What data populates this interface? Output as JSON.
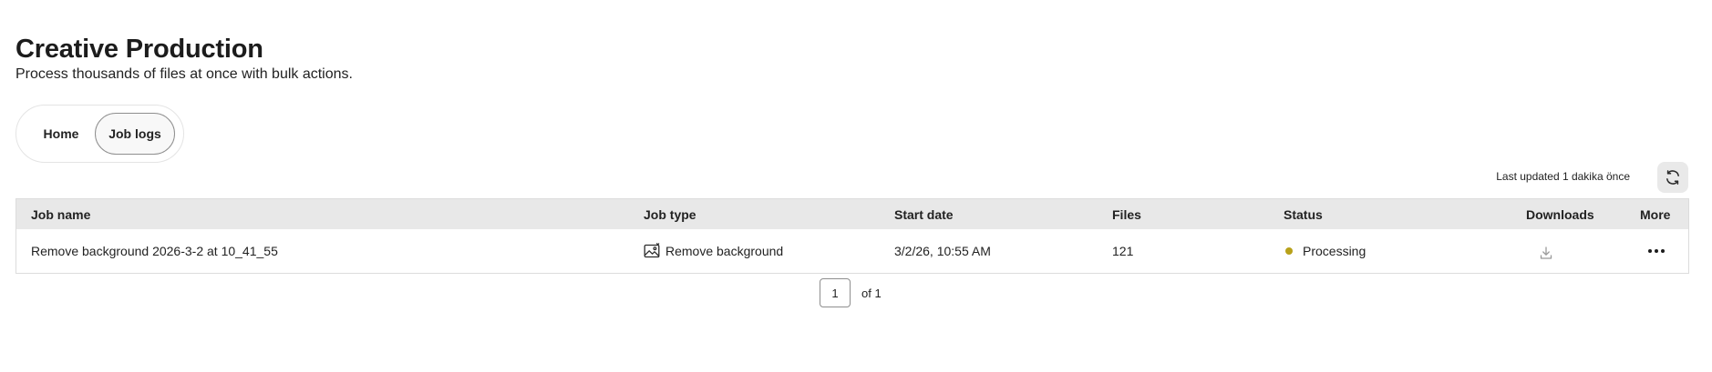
{
  "header": {
    "title": "Creative Production",
    "subtitle": "Process thousands of files at once with bulk actions."
  },
  "tabs": [
    {
      "label": "Home",
      "active": false
    },
    {
      "label": "Job logs",
      "active": true
    }
  ],
  "toolbar": {
    "last_updated": "Last updated 1 dakika önce",
    "refresh_icon": "refresh-icon"
  },
  "table": {
    "columns": [
      "Job name",
      "Job type",
      "Start date",
      "Files",
      "Status",
      "Downloads",
      "More"
    ],
    "rows": [
      {
        "job_name": "Remove background 2026-3-2 at 10_41_55",
        "job_type": "Remove background",
        "job_type_icon": "image-edit-icon",
        "start_date": "3/2/26, 10:55 AM",
        "files": "121",
        "status": "Processing",
        "status_color": "#b8a11a",
        "download_icon": "download-icon",
        "more_icon": "more-icon"
      }
    ]
  },
  "pagination": {
    "current_page": "1",
    "of_label": "of 1"
  }
}
